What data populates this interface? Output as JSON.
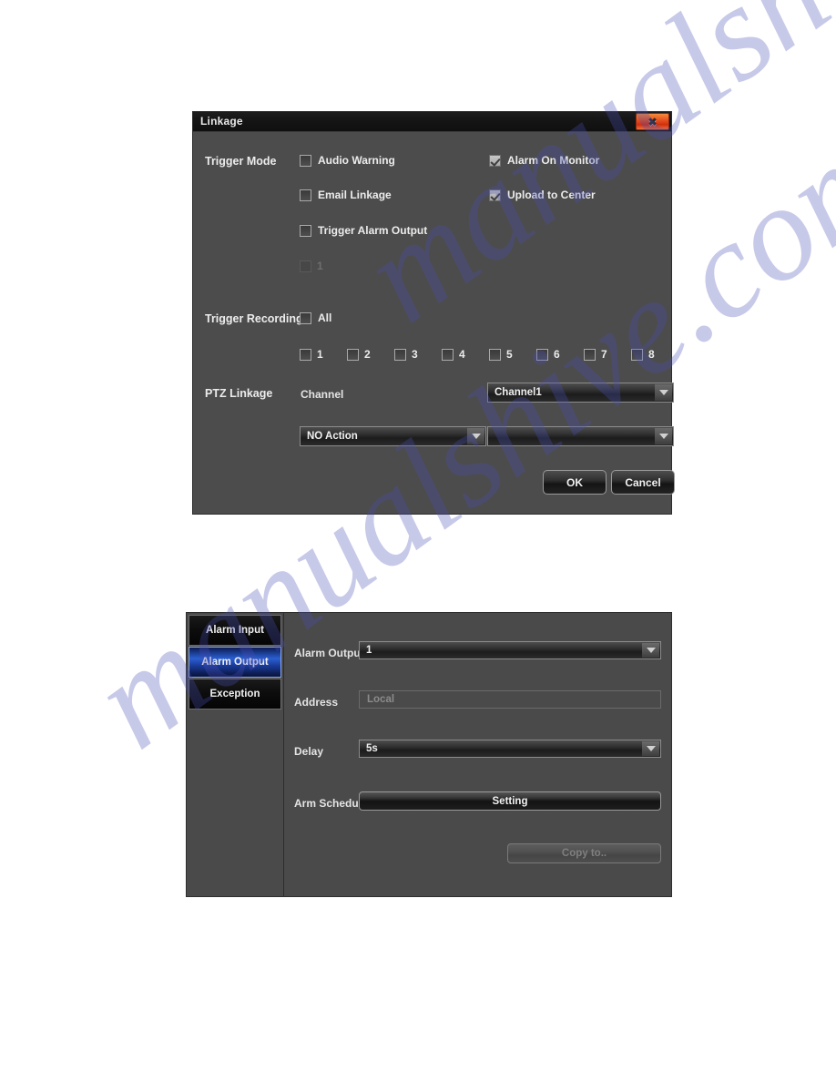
{
  "linkage_dialog": {
    "title": "Linkage",
    "close_icon": "close-icon",
    "trigger_mode": {
      "label": "Trigger Mode",
      "options": [
        {
          "label": "Audio Warning",
          "checked": false
        },
        {
          "label": "Alarm On Monitor",
          "checked": true
        },
        {
          "label": "Email Linkage",
          "checked": false
        },
        {
          "label": "Upload to Center",
          "checked": true
        },
        {
          "label": "Trigger Alarm Output",
          "checked": false
        }
      ],
      "alarm_output_channels": [
        {
          "label": "1",
          "checked": false,
          "disabled": true
        }
      ]
    },
    "trigger_recording": {
      "label": "Trigger Recording",
      "all_label": "All",
      "all_checked": false,
      "channels": [
        {
          "label": "1",
          "checked": false
        },
        {
          "label": "2",
          "checked": false
        },
        {
          "label": "3",
          "checked": false
        },
        {
          "label": "4",
          "checked": false
        },
        {
          "label": "5",
          "checked": false
        },
        {
          "label": "6",
          "checked": false
        },
        {
          "label": "7",
          "checked": false
        },
        {
          "label": "8",
          "checked": false
        }
      ]
    },
    "ptz_linkage": {
      "label": "PTZ Linkage",
      "channel_label": "Channel",
      "channel_value": "Channel1",
      "action_value": "NO Action",
      "preset_value": ""
    },
    "buttons": {
      "ok": "OK",
      "cancel": "Cancel"
    }
  },
  "alarm_panel": {
    "tabs": [
      {
        "label": "Alarm Input",
        "active": false
      },
      {
        "label": "Alarm Output",
        "active": true
      },
      {
        "label": "Exception",
        "active": false
      }
    ],
    "fields": {
      "alarm_output_label": "Alarm Output",
      "alarm_output_value": "1",
      "address_label": "Address",
      "address_value": "Local",
      "delay_label": "Delay",
      "delay_value": "5s",
      "arm_schedule_label": "Arm Schedule",
      "arm_schedule_button": "Setting",
      "copy_to_button": "Copy to.."
    }
  },
  "watermark": {
    "text_a": "manualshive.com",
    "text_b": "manualshive.com"
  }
}
